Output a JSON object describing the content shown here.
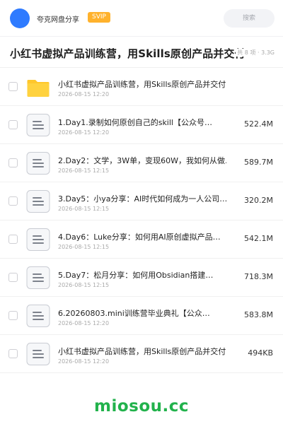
{
  "header": {
    "username": "夸克网盘分享",
    "badge": "SVIP",
    "search_label": "搜索"
  },
  "share": {
    "title": "小红书虚拟产品训练营，用Skills原创产品并交付",
    "meta": "共 8 项 · 3.3G"
  },
  "files": [
    {
      "type": "folder",
      "name": "小红书虚拟产品训练营，用Skills原创产品并交付",
      "date": "2026-08-15 12:20",
      "size": ""
    },
    {
      "type": "doc",
      "name": "1.Day1.录制如何原创自己的skill【公众号…",
      "date": "2026-08-15 12:20",
      "size": "522.4M"
    },
    {
      "type": "doc",
      "name": "2.Day2：文学，3W单，变现60W，我如何从做…",
      "date": "2026-08-15 12:15",
      "size": "589.7M"
    },
    {
      "type": "doc",
      "name": "3.Day5：小ya分享：AI时代如何成为一人公司…",
      "date": "2026-08-15 12:15",
      "size": "320.2M"
    },
    {
      "type": "doc",
      "name": "4.Day6：Luke分享：如何用AI原创虚拟产品…",
      "date": "2026-08-15 12:15",
      "size": "542.1M"
    },
    {
      "type": "doc",
      "name": "5.Day7：松月分享：如何用Obsidian搭建…",
      "date": "2026-08-15 12:15",
      "size": "718.3M"
    },
    {
      "type": "doc",
      "name": "6.20260803.mini训练营毕业典礼【公众…",
      "date": "2026-08-15 12:20",
      "size": "583.8M"
    },
    {
      "type": "doc",
      "name": "小红书虚拟产品训练营，用Skills原创产品并交付…",
      "date": "2026-08-15 12:20",
      "size": "494KB"
    }
  ],
  "watermark": "miosou.cc",
  "colors": {
    "avatar": "#2f7bff",
    "svip_badge": "#ffb22d",
    "folder": "#ffc72c",
    "watermark": "#22b24c"
  }
}
